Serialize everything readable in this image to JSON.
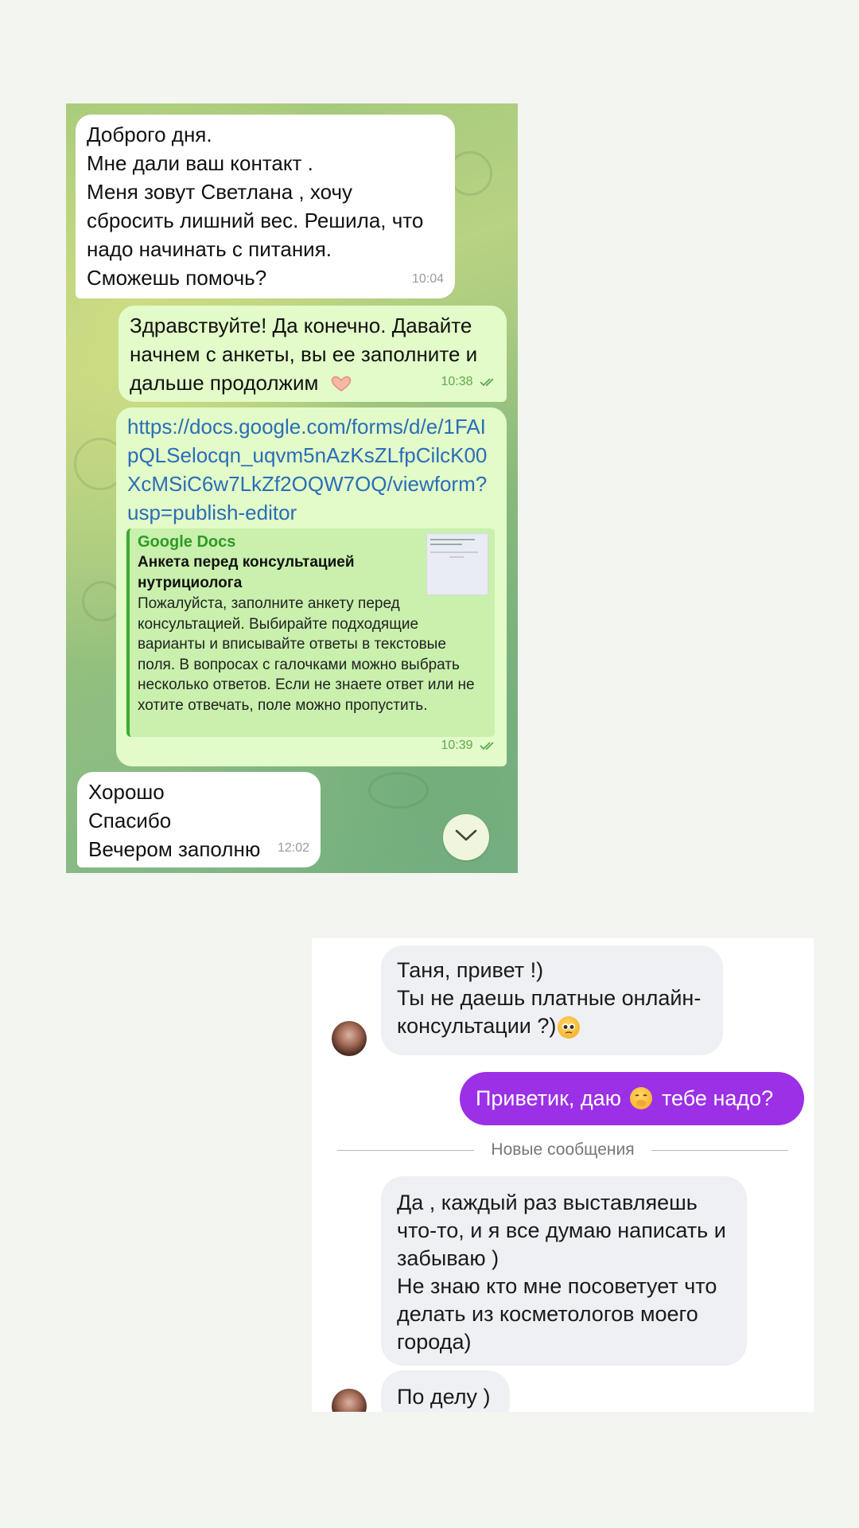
{
  "telegram": {
    "messages": [
      {
        "text": "Доброго дня.\nМне дали ваш контакт .\nМеня зовут Светлана , хочу сбросить лишний вес. Решила, что надо начинать с питания.\nСможешь помочь?",
        "time": "10:04"
      },
      {
        "text": "Здравствуйте! Да конечно. Давайте начнем с анкеты, вы ее заполните и дальше продолжим",
        "time": "10:38"
      },
      {
        "link": "https://docs.google.com/forms/d/e/1FAIpQLSelocqn_uqvm5nAzKsZLfpCilcK00XcMSiC6w7LkZf2OQW7OQ/viewform?usp=publish-editor",
        "time": "10:39",
        "preview": {
          "site": "Google Docs",
          "title": "Анкета перед консультацией нутрициолога",
          "description": "Пожалуйста, заполните анкету перед консультацией. Выбирайте подходящие варианты и вписывайте ответы в текстовые поля. В вопросах с галочками можно выбрать несколько ответов. Если не знаете ответ или не хотите отвечать, поле можно пропустить."
        }
      },
      {
        "text": "Хорошо\nСпасибо\nВечером заполню",
        "time": "12:02"
      }
    ],
    "icons": {
      "read": "double-check-icon",
      "scroll": "chevron-down-icon",
      "emoji": "heart-hands-emoji"
    },
    "colors": {
      "incoming": "#ffffff",
      "outgoing": "#e2fbc8",
      "link": "#2a6db8",
      "accent": "#3cab2f"
    }
  },
  "chat2": {
    "messages": [
      {
        "text": "Таня, привет !)\nТы не даешь платные онлайн-консультации ?)"
      },
      {
        "text_before": "Приветик, даю",
        "text_after": "тебе надо?"
      },
      {
        "text": "Да , каждый раз выставляешь что-то, и я все думаю написать и забываю )\nНе знаю кто мне посоветует что делать из косметологов моего города)"
      },
      {
        "text": "По делу )"
      }
    ],
    "divider": "Новые сообщения",
    "colors": {
      "outgoing": "#9b30e6",
      "incoming": "#eef0f3"
    }
  }
}
